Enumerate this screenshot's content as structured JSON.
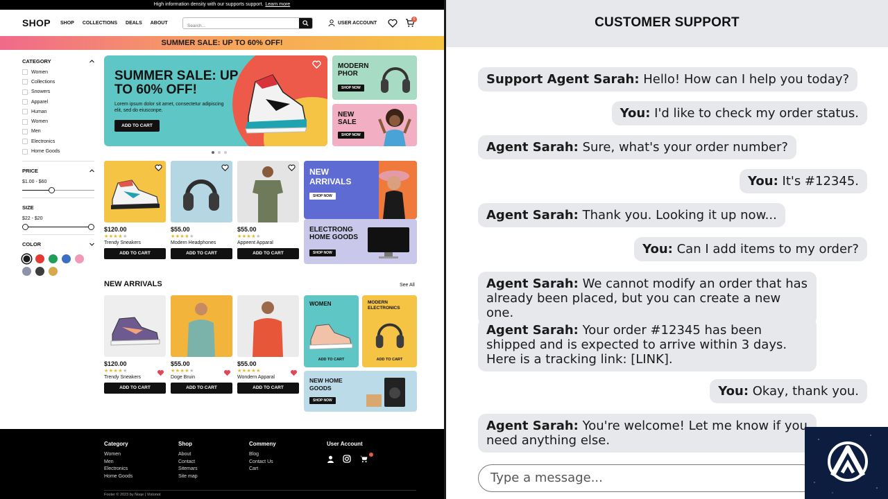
{
  "announcement": {
    "text": "High information density with our supports support.",
    "link": "Learn more"
  },
  "header": {
    "logo": "SHOP",
    "nav": [
      "SHOP",
      "COLLECTIONS",
      "DEALS",
      "ABOUT"
    ],
    "search_placeholder": "Search...",
    "account_label": "USER ACCOUNT",
    "cart_count": "0"
  },
  "sale_banner": "SUMMER SALE: UP TO 60% OFF!",
  "sidebar": {
    "category_title": "CATEGORY",
    "categories": [
      "Women",
      "Collections",
      "Snowers",
      "Apparel",
      "Human",
      "Women",
      "Men",
      "Electronics",
      "Home Goods"
    ],
    "price_title": "PRICE",
    "price_range": "$1.00 - $60",
    "size_title": "SIZE",
    "size_range": "$22 - $20",
    "color_title": "COLOR",
    "colors": [
      "#1a1a1a",
      "#e53935",
      "#1e9e5a",
      "#3b6fc4",
      "#ee9ab8",
      "#8e93a8",
      "#3d3d3d",
      "#d8a84e"
    ]
  },
  "hero": {
    "title": "SUMMER SALE: UP TO 60% OFF!",
    "body": "Lorem ipsum dolor sit amet, consectetur adipiscing elit, sed do eiusconpe.",
    "button": "ADD TO CART"
  },
  "promos": {
    "modern": {
      "title": "MODERN PHOR",
      "button": "SHOP NOW"
    },
    "new_sale": {
      "title": "NEW SALE",
      "button": "SHOP NOW"
    },
    "new_arrivals": {
      "title": "NEW ARRIVALS",
      "button": "SHOP NOW"
    },
    "electrong": {
      "title": "ELECTRONG HOME GOODS",
      "button": "SHOP NOW"
    },
    "women": {
      "title": "WOMEN",
      "button": "ADD TO CART"
    },
    "modern_electronics": {
      "title": "MODERN ELECTRONICS",
      "button": "ADD TO CART"
    },
    "new_home": {
      "title": "NEW HOME GOODS",
      "button": "SHOP NOW"
    }
  },
  "products_row1": [
    {
      "price": "$120.00",
      "name": "Trendy Sneakers",
      "rating": 4,
      "button": "ADD TO CART"
    },
    {
      "price": "$55.00",
      "name": "Modern Headphones",
      "rating": 4,
      "button": "ADD TO CART"
    },
    {
      "price": "$55.00",
      "name": "Appeent Apparal",
      "rating": 4,
      "button": "ADD TO CART"
    }
  ],
  "new_arrivals": {
    "title": "NEW ARRIVALS",
    "see_all": "See All",
    "items": [
      {
        "price": "$120.00",
        "name": "Trendy Sneakers",
        "rating": 4,
        "button": "ADD TO CART"
      },
      {
        "price": "$55.00",
        "name": "Doge Bruin",
        "rating": 4,
        "button": "ADD TO CART"
      },
      {
        "price": "$55.00",
        "name": "Wondern Apparal",
        "rating": 5,
        "button": "ADD TO CART"
      }
    ]
  },
  "footer": {
    "cols": [
      {
        "title": "Category",
        "links": [
          "Women",
          "Men",
          "Electronics",
          "Home Goods"
        ]
      },
      {
        "title": "Shop",
        "links": [
          "About",
          "Contact",
          "Sitemars",
          "Site map"
        ]
      },
      {
        "title": "Commeny",
        "links": [
          "Blog",
          "Contact Us",
          "Cart"
        ]
      },
      {
        "title": "User Account",
        "links": []
      }
    ],
    "copyright": "Footer © 2023 by Noqe |   Vistonot"
  },
  "chat": {
    "title": "CUSTOMER SUPPORT",
    "messages": [
      {
        "speaker": "Support Agent Sarah:",
        "text": "Hello! How can I help you today?",
        "side": "left"
      },
      {
        "speaker": "You:",
        "text": "I'd like to check my order status.",
        "side": "right"
      },
      {
        "speaker": "Agent Sarah:",
        "text": "Sure, what's your order number?",
        "side": "left"
      },
      {
        "speaker": "You:",
        "text": "It's #12345.",
        "side": "right"
      },
      {
        "speaker": "Agent Sarah:",
        "text": "Thank you. Looking it up now...",
        "side": "left"
      },
      {
        "speaker": "You:",
        "text": "Can I add items to my order?",
        "side": "right"
      },
      {
        "speaker": "Agent Sarah:",
        "text": "We cannot modify an order that has already been placed, but you can create a new one.",
        "side": "left"
      },
      {
        "speaker": "Agent Sarah:",
        "text": "Your order #12345 has been shipped and is expected to arrive within 3 days. Here is a tracking link: [LINK].",
        "side": "left"
      },
      {
        "speaker": "You:",
        "text": "Okay, thank you.",
        "side": "right"
      },
      {
        "speaker": "Agent Sarah:",
        "text": "You're welcome! Let me know if you need anything else.",
        "side": "left"
      }
    ],
    "input_placeholder": "Type a message..."
  }
}
